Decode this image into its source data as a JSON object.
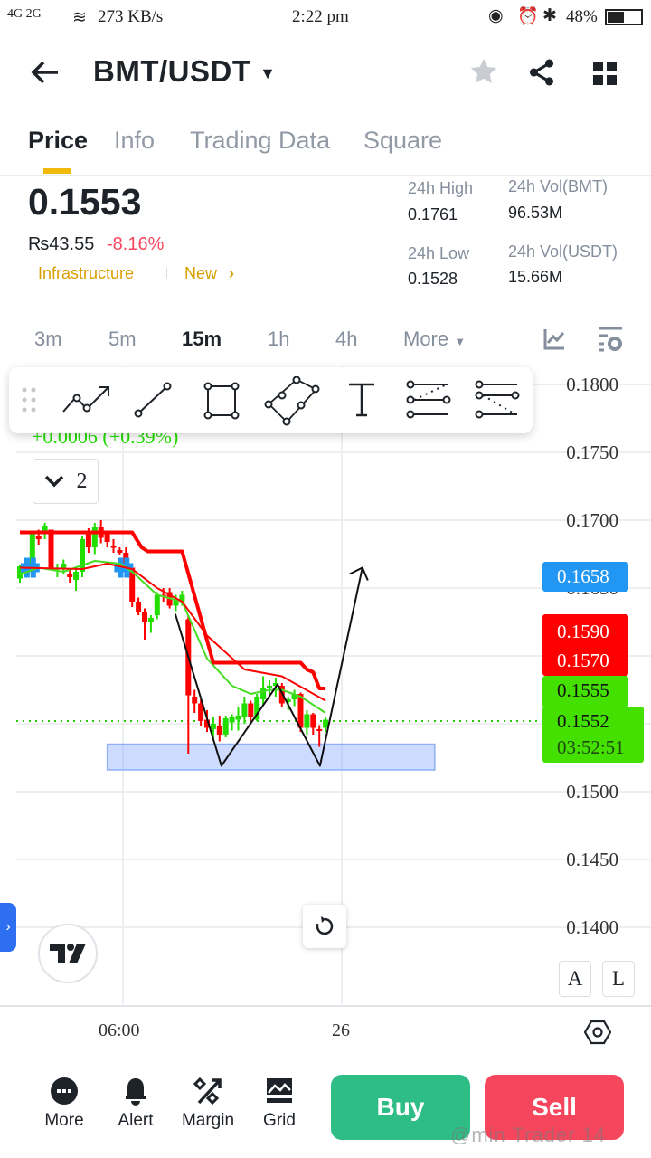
{
  "status_bar": {
    "network": "4G 2G",
    "speed": "273 KB/s",
    "time": "2:22 pm",
    "battery": "48%"
  },
  "header": {
    "pair": "BMT/USDT"
  },
  "tabs": [
    {
      "label": "Price"
    },
    {
      "label": "Info"
    },
    {
      "label": "Trading Data"
    },
    {
      "label": "Square"
    }
  ],
  "price": {
    "last": "0.1553",
    "fiat": "₨43.55",
    "change": "-8.16%",
    "tag1": "Infrastructure",
    "tag2": "New"
  },
  "stats": {
    "high_label": "24h High",
    "high": "0.1761",
    "low_label": "24h Low",
    "low": "0.1528",
    "vol_base_label": "24h Vol(BMT)",
    "vol_base": "96.53M",
    "vol_quote_label": "24h Vol(USDT)",
    "vol_quote": "15.66M"
  },
  "timeframes": [
    "3m",
    "5m",
    "15m",
    "1h",
    "4h",
    "More"
  ],
  "legend": {
    "change": "+0.0006 (+0.39%)",
    "indicator_count": "2"
  },
  "price_labels": {
    "blue": "0.1658",
    "red1": "0.1590",
    "red2": "0.1570",
    "green1": "0.1555",
    "green2": "0.1552",
    "countdown": "03:52:51"
  },
  "scale_buttons": {
    "auto": "A",
    "log": "L"
  },
  "bottom_nav": [
    {
      "label": "More"
    },
    {
      "label": "Alert"
    },
    {
      "label": "Margin"
    },
    {
      "label": "Grid"
    }
  ],
  "actions": {
    "buy": "Buy",
    "sell": "Sell"
  },
  "watermark": "@min Trader 14",
  "colors": {
    "up": "#22dd00",
    "down": "#ff0000",
    "buy": "#2ebd85",
    "sell": "#f6465d",
    "accent": "#f0b90b"
  },
  "chart_data": {
    "type": "candlestick",
    "interval": "15m",
    "ylim": [
      0.139,
      0.182
    ],
    "y_ticks": [
      "0.1800",
      "0.1750",
      "0.1700",
      "0.1650",
      "0.1600",
      "0.1550",
      "0.1500",
      "0.1450",
      "0.1400"
    ],
    "x_ticks": [
      "06:00",
      "26"
    ],
    "candles": [
      [
        0.1657,
        0.1667,
        0.1654,
        0.1666
      ],
      [
        0.1663,
        0.167,
        0.166,
        0.1668
      ],
      [
        0.1664,
        0.1692,
        0.1662,
        0.169
      ],
      [
        0.1688,
        0.1693,
        0.1682,
        0.1686
      ],
      [
        0.169,
        0.1698,
        0.1686,
        0.1696
      ],
      [
        0.1693,
        0.1693,
        0.1663,
        0.1665
      ],
      [
        0.1664,
        0.1668,
        0.1658,
        0.1665
      ],
      [
        0.1665,
        0.1671,
        0.166,
        0.1668
      ],
      [
        0.166,
        0.1663,
        0.1654,
        0.1658
      ],
      [
        0.1656,
        0.1665,
        0.1648,
        0.1662
      ],
      [
        0.1662,
        0.1688,
        0.1658,
        0.1686
      ],
      [
        0.169,
        0.1694,
        0.1676,
        0.168
      ],
      [
        0.168,
        0.1698,
        0.1675,
        0.1695
      ],
      [
        0.1695,
        0.17,
        0.1683,
        0.1687
      ],
      [
        0.169,
        0.1692,
        0.168,
        0.1684
      ],
      [
        0.1681,
        0.1686,
        0.1676,
        0.168
      ],
      [
        0.1678,
        0.168,
        0.1674,
        0.1676
      ],
      [
        0.1676,
        0.168,
        0.166,
        0.1662
      ],
      [
        0.1665,
        0.1668,
        0.1636,
        0.164
      ],
      [
        0.164,
        0.1643,
        0.163,
        0.1632
      ],
      [
        0.1632,
        0.1635,
        0.1612,
        0.1625
      ],
      [
        0.1625,
        0.163,
        0.1617,
        0.1628
      ],
      [
        0.163,
        0.1647,
        0.1627,
        0.1645
      ],
      [
        0.1645,
        0.165,
        0.164,
        0.1644
      ],
      [
        0.1647,
        0.165,
        0.1635,
        0.1637
      ],
      [
        0.1637,
        0.1645,
        0.1633,
        0.1641
      ],
      [
        0.164,
        0.1648,
        0.1637,
        0.1645
      ],
      [
        0.1627,
        0.163,
        0.1528,
        0.1571
      ],
      [
        0.157,
        0.1575,
        0.1558,
        0.1565
      ],
      [
        0.1565,
        0.1568,
        0.1548,
        0.1552
      ],
      [
        0.1553,
        0.156,
        0.1544,
        0.1547
      ],
      [
        0.1546,
        0.1555,
        0.1538,
        0.155
      ],
      [
        0.1548,
        0.1556,
        0.1537,
        0.1542
      ],
      [
        0.1542,
        0.1556,
        0.154,
        0.1554
      ],
      [
        0.1551,
        0.1557,
        0.1545,
        0.1555
      ],
      [
        0.1553,
        0.1562,
        0.1545,
        0.1556
      ],
      [
        0.1555,
        0.157,
        0.155,
        0.1565
      ],
      [
        0.1565,
        0.1567,
        0.1552,
        0.1555
      ],
      [
        0.1553,
        0.1572,
        0.1552,
        0.157
      ],
      [
        0.1568,
        0.1585,
        0.1564,
        0.1576
      ],
      [
        0.1576,
        0.1582,
        0.157,
        0.1578
      ],
      [
        0.1578,
        0.1584,
        0.157,
        0.158
      ],
      [
        0.1578,
        0.158,
        0.1562,
        0.1565
      ],
      [
        0.1566,
        0.157,
        0.156,
        0.1568
      ],
      [
        0.1568,
        0.1575,
        0.1563,
        0.1572
      ],
      [
        0.1572,
        0.1573,
        0.1544,
        0.1547
      ],
      [
        0.1547,
        0.156,
        0.1542,
        0.1557
      ],
      [
        0.1557,
        0.1558,
        0.1542,
        0.1547
      ],
      [
        0.1546,
        0.1549,
        0.1533,
        0.1545
      ],
      [
        0.1547,
        0.1555,
        0.1544,
        0.1553
      ]
    ],
    "band_upper": [
      [
        0,
        0.1691
      ],
      [
        18,
        0.1691
      ],
      [
        19.5,
        0.168
      ],
      [
        20.5,
        0.1677
      ],
      [
        26,
        0.1677
      ],
      [
        31,
        0.1595
      ],
      [
        45,
        0.1595
      ],
      [
        46,
        0.159
      ],
      [
        47,
        0.1588
      ],
      [
        48,
        0.1576
      ],
      [
        49,
        0.1576
      ]
    ],
    "ma_red": [
      [
        0,
        0.1665
      ],
      [
        10,
        0.1664
      ],
      [
        14,
        0.1668
      ],
      [
        18,
        0.1664
      ],
      [
        22,
        0.165
      ],
      [
        26,
        0.164
      ],
      [
        30,
        0.1615
      ],
      [
        36,
        0.159
      ],
      [
        42,
        0.1585
      ],
      [
        49,
        0.1567
      ]
    ],
    "ma_green": [
      [
        0,
        0.166
      ],
      [
        3,
        0.1665
      ],
      [
        7,
        0.1662
      ],
      [
        12,
        0.167
      ],
      [
        16,
        0.1668
      ],
      [
        18,
        0.1662
      ],
      [
        22,
        0.1645
      ],
      [
        26,
        0.164
      ],
      [
        30,
        0.1598
      ],
      [
        34,
        0.1578
      ],
      [
        37,
        0.1572
      ],
      [
        40,
        0.1575
      ],
      [
        42,
        0.1575
      ],
      [
        45,
        0.157
      ],
      [
        49,
        0.1558
      ]
    ],
    "markers_blue": [
      [
        1,
        0.1665
      ],
      [
        2,
        0.1665
      ],
      [
        16,
        0.1665
      ],
      [
        17,
        0.1665
      ]
    ],
    "drawing_path": [
      [
        24.9,
        0.1631
      ],
      [
        32.3,
        0.1519
      ],
      [
        41.3,
        0.1579
      ],
      [
        48.1,
        0.1519
      ],
      [
        54.9,
        0.1665
      ]
    ],
    "zone": {
      "from_index": 14,
      "to_index": 66.5,
      "low": 0.1516,
      "high": 0.1535
    },
    "last_price_line": 0.1552
  }
}
